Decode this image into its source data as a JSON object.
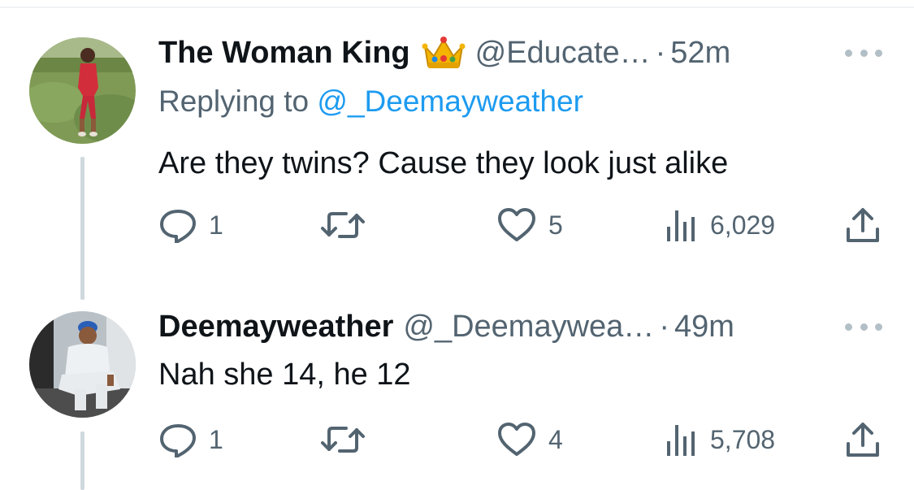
{
  "tweets": [
    {
      "author_name": "The Woman King",
      "author_badge_icon": "crown-emoji",
      "handle": "@Educate…",
      "separator": "·",
      "time": "52m",
      "replying_prefix": "Replying to ",
      "replying_to": "@_Deemayweather",
      "text": "Are they twins? Cause they look just alike",
      "stats": {
        "replies": "1",
        "retweets": "",
        "likes": "5",
        "views": "6,029"
      }
    },
    {
      "author_name": "Deemayweather",
      "handle": "@_Deemaywea…",
      "separator": "·",
      "time": "49m",
      "text": "Nah she 14, he 12",
      "stats": {
        "replies": "1",
        "retweets": "",
        "likes": "4",
        "views": "5,708"
      }
    }
  ],
  "icons": {
    "reply": "reply-icon",
    "retweet": "retweet-icon",
    "like": "heart-icon",
    "views": "views-icon",
    "share": "share-icon",
    "more": "more-icon"
  },
  "colors": {
    "text": "#0f1419",
    "secondary": "#536471",
    "mention": "#1d9bf0",
    "thread_line": "#cfd9de"
  }
}
